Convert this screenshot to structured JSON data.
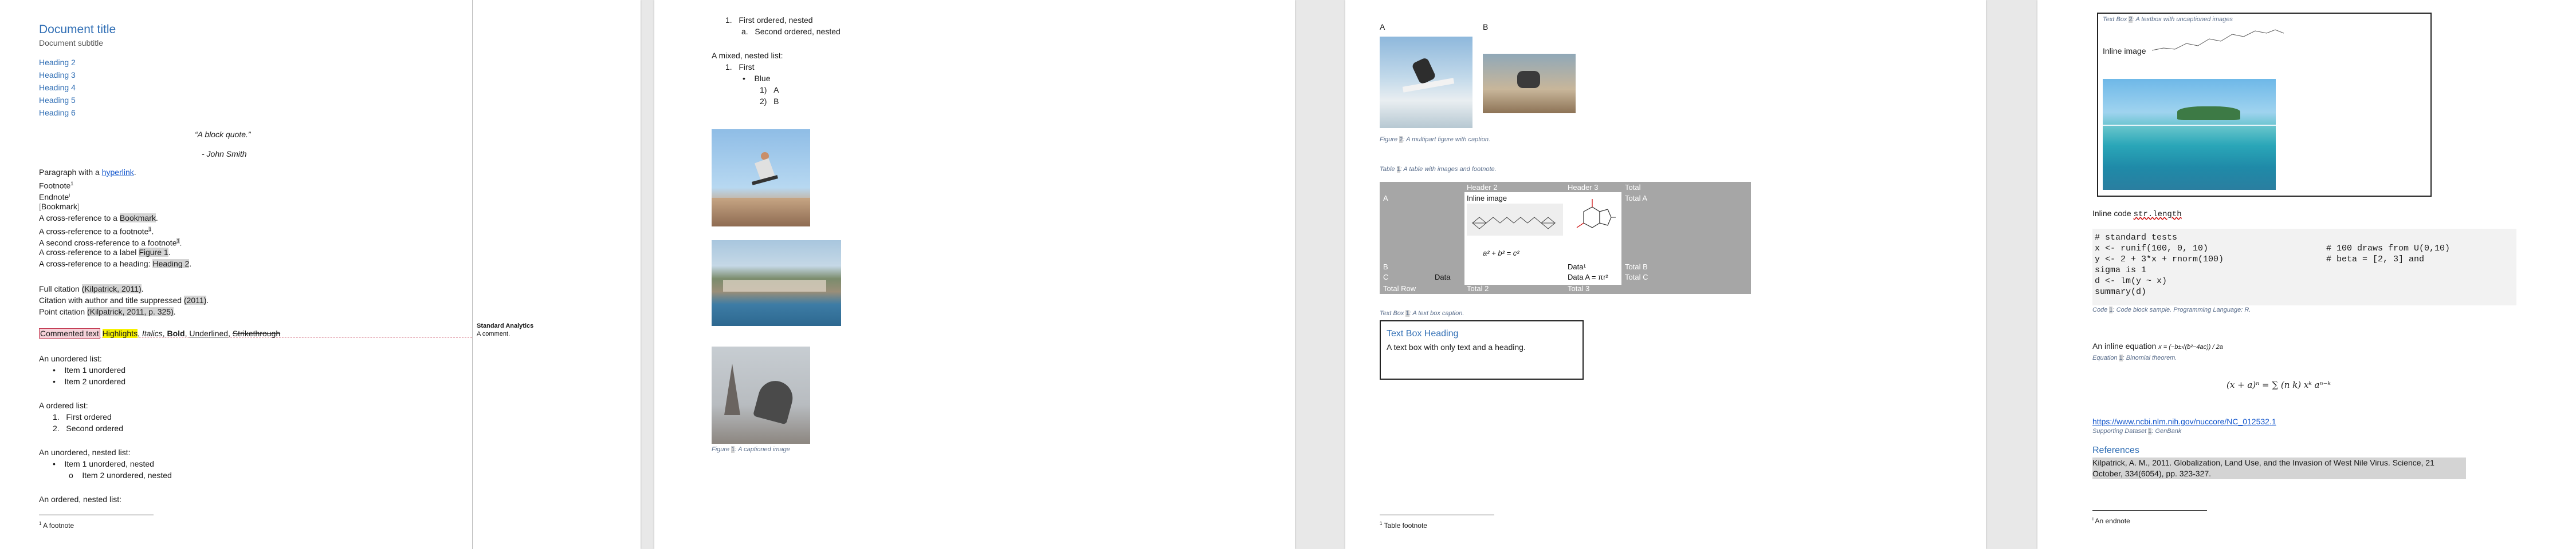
{
  "page1": {
    "title": "Document title",
    "subtitle": "Document subtitle",
    "headings": [
      "Heading 2",
      "Heading 3",
      "Heading 4",
      "Heading 5",
      "Heading 6"
    ],
    "quote": "“A block quote.”",
    "quote_author": "- John Smith",
    "para_prefix": "Paragraph with a ",
    "hyperlink": "hyperlink",
    "para_suffix": ".",
    "footnote": "Footnote",
    "footnote_mark": "1",
    "endnote": "Endnote",
    "endnote_mark": "i",
    "bookmark": "Bookmark",
    "xref1_prefix": "A cross-reference to a ",
    "xref1_field": "Bookmark",
    "xref2": "A cross-reference to a footnote",
    "xref2_mark": "1",
    "xref3": "A second cross-reference to a footnote",
    "xref3_mark": "1",
    "xref4_prefix": "A cross-reference to a label ",
    "xref4_field": "Figure 1",
    "xref5_prefix": "A cross-reference to a heading: ",
    "xref5_field": "Heading 2",
    "cite1_prefix": "Full citation ",
    "cite1_field": "(Kilpatrick, 2011)",
    "cite2_prefix": "Citation with author and title suppressed ",
    "cite2_field": "(2011)",
    "cite3_prefix": "Point citation ",
    "cite3_field": "(Kilpatrick, 2011, p. 325)",
    "commented_text": "Commented text",
    "highlights": "Highlights",
    "italics": "Italics",
    "bold": "Bold",
    "underlined": "Underlined",
    "strikethrough": "Strikethrough",
    "comment_author": "Standard Analytics",
    "comment_text": "A comment.",
    "unordered_title": "An unordered list:",
    "unordered_items": [
      "Item 1 unordered",
      "Item 2 unordered"
    ],
    "ordered_title": "A ordered list:",
    "ordered_items": [
      "First ordered",
      "Second ordered"
    ],
    "un_nested_title": "An unordered, nested list:",
    "un_nested_item": "Item 1 unordered, nested",
    "un_nested_sub": "Item 2 unordered, nested",
    "ord_nested_title": "An ordered, nested list:",
    "footnote_text": "A footnote",
    "footnote_num": "1"
  },
  "page2": {
    "list1": "First ordered, nested",
    "list1_sub": "Second ordered, nested",
    "mixed_title": "A mixed, nested list:",
    "mixed_first": "First",
    "mixed_blue": "Blue",
    "mixed_a": "A",
    "mixed_b": "B",
    "caption_label": "Figure",
    "caption_text": "A captioned image"
  },
  "page3": {
    "label_a": "A",
    "label_b": "B",
    "fig_caption_label": "Figure",
    "fig_caption": "A multipart figure with caption.",
    "table_caption_label": "Table",
    "table_caption": "A table with images and footnote.",
    "table": {
      "headers": [
        "",
        "Header 2",
        "Header 3",
        "Total"
      ],
      "row_a_label": "A",
      "inline_image": "Inline image",
      "total_a": "Total A",
      "equation": "a² + b² = c²",
      "row_b": [
        "B",
        "",
        "Data¹",
        "Total B"
      ],
      "row_c": [
        "C",
        "Data",
        "Data A = πr²",
        "Total C"
      ],
      "row_total": [
        "Total Row",
        "Total 2",
        "Total 3",
        ""
      ]
    },
    "textbox_caption_label": "Text Box",
    "textbox_caption": "A text box caption.",
    "textbox_heading": "Text Box Heading",
    "textbox_text": "A text box with only text and a heading.",
    "footnote_text": "Table footnote",
    "footnote_num": "1"
  },
  "page4": {
    "textbox_label": "Text Box",
    "textbox_caption": "A textbox with uncaptioned images",
    "inline_image_label": "Inline image",
    "inline_code_prefix": "Inline code ",
    "inline_code": "str.length",
    "code_lines": [
      "# standard tests",
      "x <- runif(100, 0, 10)",
      "y <- 2 + 3*x + rnorm(100)",
      "sigma is 1",
      "d <- lm(y ~ x)",
      "summary(d)"
    ],
    "code_comments": [
      "# 100 draws from U(0,10)",
      "# beta = [2, 3] and"
    ],
    "code_caption_label": "Code",
    "code_caption": "Code block sample. Programming Language: R.",
    "inline_eq_prefix": "An inline equation ",
    "inline_eq": "x = (−b±√(b²−4ac)) / 2a",
    "eq_caption_label": "Equation",
    "eq_caption": "Binomial theorem.",
    "display_eq": "(x + a)ⁿ = ∑ (n k) xᵏ aⁿ⁻ᵏ",
    "url": "https://www.ncbi.nlm.nih.gov/nuccore/NC_012532.1",
    "dataset_label": "Supporting Dataset",
    "dataset_text": "GenBank",
    "references_heading": "References",
    "reference": "Kilpatrick, A. M., 2011. Globalization, Land Use, and the Invasion of West Nile Virus. Science, 21 October, 334(6054), pp. 323-327.",
    "endnote_text": "An endnote",
    "endnote_num": "i"
  }
}
